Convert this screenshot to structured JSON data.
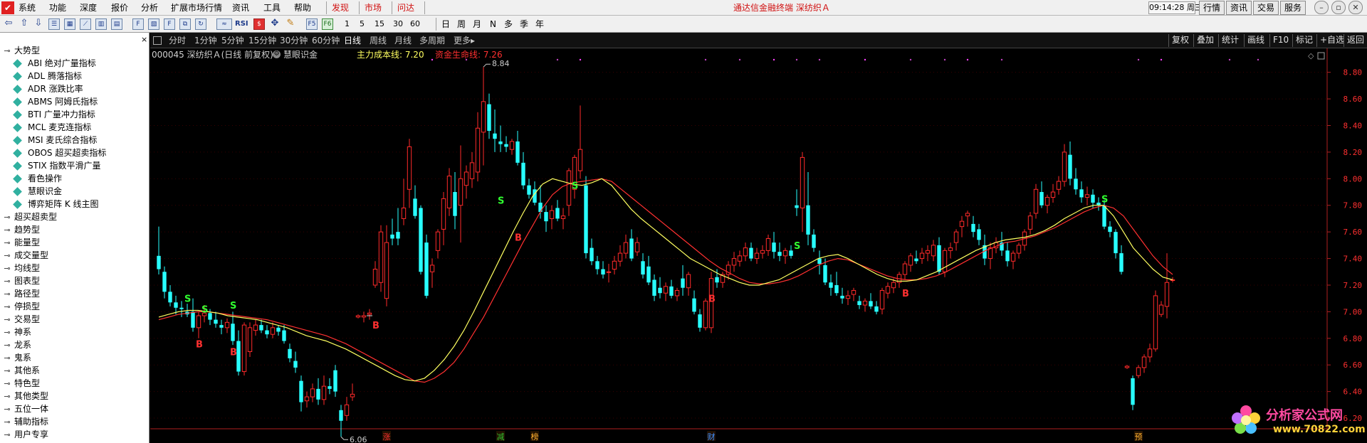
{
  "menubar": {
    "items": [
      "系统",
      "功能",
      "深度",
      "报价",
      "分析",
      "扩展市场行情",
      "资讯",
      "工具",
      "帮助"
    ],
    "tabs": [
      "发现",
      "市场",
      "问达"
    ],
    "title": "通达信金融终端   深纺织Ａ",
    "clock": "09:14:28 周三",
    "buttons": [
      "行情",
      "资讯",
      "交易",
      "服务"
    ],
    "window_controls": [
      "minimize",
      "restore",
      "close"
    ]
  },
  "toolbar": {
    "icons": [
      "back-icon",
      "up-icon",
      "down-icon",
      "list-icon",
      "grid-icon",
      "line-chart-icon",
      "bar-chart-icon",
      "f10-icon",
      "f1-icon",
      "table-icon",
      "f2-icon",
      "multi-window-icon",
      "refresh-icon",
      "trend-icon",
      "rsi-icon",
      "dollar-icon",
      "move-icon",
      "pencil-icon",
      "f5-icon",
      "f6-icon"
    ],
    "rsi_label": "RSI",
    "numbers": [
      "1",
      "5",
      "15",
      "30",
      "60"
    ],
    "periods": [
      "日",
      "周",
      "月",
      "N",
      "多",
      "季",
      "年"
    ]
  },
  "sidebar": {
    "close": "×",
    "groups": [
      {
        "label": "大势型",
        "expanded": true,
        "children": [
          "ABI 绝对广量指标",
          "ADL 腾落指标",
          "ADR 涨跌比率",
          "ABMS 阿姆氏指标",
          "BTI 广量冲力指标",
          "MCL 麦克连指标",
          "MSI 麦氏综合指标",
          "OBOS 超买超卖指标",
          "STIX 指数平滑广量",
          "看色操作",
          "慧眼识金",
          "博弈矩阵 K 线主图"
        ]
      },
      {
        "label": "超买超卖型"
      },
      {
        "label": "趋势型"
      },
      {
        "label": "能量型"
      },
      {
        "label": "成交量型"
      },
      {
        "label": "均线型"
      },
      {
        "label": "图表型"
      },
      {
        "label": "路径型"
      },
      {
        "label": "停损型"
      },
      {
        "label": "交易型"
      },
      {
        "label": "神系"
      },
      {
        "label": "龙系"
      },
      {
        "label": "鬼系"
      },
      {
        "label": "其他系"
      },
      {
        "label": "特色型"
      },
      {
        "label": "其他类型"
      },
      {
        "label": "五位一体"
      },
      {
        "label": "辅助指标"
      },
      {
        "label": "用户专享"
      }
    ]
  },
  "periodbar": {
    "periods": [
      "分时",
      "1分钟",
      "5分钟",
      "15分钟",
      "30分钟",
      "60分钟",
      "日线",
      "周线",
      "月线",
      "多周期",
      "更多▸"
    ],
    "active": "日线",
    "right_buttons": [
      "复权",
      "叠加",
      "统计",
      "画线",
      "F10",
      "标记",
      "+自选",
      "返回"
    ]
  },
  "info": {
    "stock": "000045 深纺织Ａ(日线 前复权)",
    "indicator": "慧眼识金",
    "cost_label": "主力成本线: 7.20",
    "life_label": "资金生命线: 7.26"
  },
  "chart_data": {
    "type": "candlestick",
    "y_ticks": [
      "8.80",
      "8.60",
      "8.40",
      "8.20",
      "8.00",
      "7.80",
      "7.60",
      "7.40",
      "7.20",
      "7.00",
      "6.80",
      "6.60",
      "6.40",
      "6.20"
    ],
    "ylim": [
      6.12,
      8.98
    ],
    "high_label": "8.84",
    "low_label": "6.06",
    "colors": {
      "up": "#ff2a2a",
      "down": "#28ffff",
      "cost_line": "#ffff60",
      "life_line": "#ff3030",
      "signal_b": "#ff3030",
      "signal_s": "#30ff30"
    },
    "candles_ohlc": [
      [
        7.42,
        7.64,
        7.28,
        7.32
      ],
      [
        7.3,
        7.34,
        7.1,
        7.15
      ],
      [
        7.15,
        7.2,
        7.04,
        7.07
      ],
      [
        7.07,
        7.12,
        6.98,
        7.03
      ],
      [
        7.03,
        7.08,
        6.96,
        7.02
      ],
      [
        7.0,
        7.06,
        6.96,
        6.98
      ],
      [
        7.0,
        7.1,
        6.85,
        6.88
      ],
      [
        6.88,
        7.0,
        6.8,
        6.97
      ],
      [
        6.97,
        7.05,
        6.92,
        6.99
      ],
      [
        6.99,
        7.02,
        6.9,
        6.94
      ],
      [
        6.94,
        7.0,
        6.88,
        6.91
      ],
      [
        6.9,
        6.94,
        6.83,
        6.88
      ],
      [
        6.88,
        6.95,
        6.84,
        6.92
      ],
      [
        6.91,
        7.0,
        6.75,
        6.78
      ],
      [
        6.78,
        6.86,
        6.52,
        6.55
      ],
      [
        6.55,
        6.92,
        6.52,
        6.9
      ],
      [
        6.7,
        6.92,
        6.66,
        6.88
      ],
      [
        6.86,
        6.94,
        6.82,
        6.9
      ],
      [
        6.9,
        6.94,
        6.84,
        6.86
      ],
      [
        6.86,
        6.9,
        6.8,
        6.83
      ],
      [
        6.83,
        6.92,
        6.8,
        6.88
      ],
      [
        6.88,
        6.9,
        6.82,
        6.85
      ],
      [
        6.86,
        6.9,
        6.76,
        6.78
      ],
      [
        6.72,
        6.76,
        6.62,
        6.65
      ],
      [
        6.63,
        6.7,
        6.54,
        6.58
      ],
      [
        6.48,
        6.52,
        6.25,
        6.32
      ],
      [
        6.33,
        6.4,
        6.28,
        6.36
      ],
      [
        6.36,
        6.46,
        6.32,
        6.42
      ],
      [
        6.42,
        6.5,
        6.3,
        6.34
      ],
      [
        6.34,
        6.52,
        6.3,
        6.44
      ],
      [
        6.44,
        6.5,
        6.38,
        6.42
      ],
      [
        6.56,
        6.6,
        6.36,
        6.4
      ],
      [
        6.26,
        6.3,
        6.06,
        6.18
      ],
      [
        6.22,
        6.36,
        6.18,
        6.3
      ],
      [
        6.36,
        6.46,
        6.33,
        6.38
      ],
      [
        6.96,
        6.98,
        6.95,
        6.97
      ],
      [
        6.96,
        7.0,
        6.92,
        6.97
      ],
      [
        6.98,
        7.02,
        6.94,
        6.99
      ],
      [
        7.2,
        7.38,
        7.18,
        7.32
      ],
      [
        7.22,
        7.65,
        7.15,
        7.6
      ],
      [
        7.1,
        7.65,
        7.04,
        7.52
      ],
      [
        7.58,
        7.7,
        7.5,
        7.55
      ],
      [
        7.6,
        7.78,
        7.5,
        7.55
      ],
      [
        7.7,
        8.0,
        7.65,
        7.78
      ],
      [
        7.92,
        8.3,
        7.78,
        8.24
      ],
      [
        7.85,
        7.95,
        7.7,
        7.72
      ],
      [
        7.78,
        7.8,
        7.28,
        7.3
      ],
      [
        7.52,
        7.58,
        7.1,
        7.12
      ],
      [
        7.3,
        7.4,
        7.18,
        7.35
      ],
      [
        7.46,
        7.62,
        7.4,
        7.6
      ],
      [
        7.62,
        7.9,
        7.5,
        7.85
      ],
      [
        7.78,
        8.08,
        7.72,
        8.02
      ],
      [
        7.9,
        8.05,
        7.62,
        7.72
      ],
      [
        7.8,
        8.25,
        7.52,
        8.0
      ],
      [
        7.95,
        8.1,
        7.85,
        8.05
      ],
      [
        8.0,
        8.2,
        7.93,
        8.12
      ],
      [
        8.05,
        8.5,
        7.98,
        8.38
      ],
      [
        8.35,
        8.84,
        8.1,
        8.58
      ],
      [
        8.56,
        8.64,
        8.3,
        8.36
      ],
      [
        8.34,
        8.52,
        8.2,
        8.3
      ],
      [
        8.28,
        8.4,
        8.2,
        8.26
      ],
      [
        8.26,
        8.32,
        8.2,
        8.24
      ],
      [
        8.22,
        8.3,
        8.18,
        8.28
      ],
      [
        8.28,
        8.36,
        8.1,
        8.12
      ],
      [
        8.12,
        8.2,
        7.92,
        7.95
      ],
      [
        7.95,
        8.0,
        7.85,
        7.88
      ],
      [
        7.92,
        7.98,
        7.8,
        7.82
      ],
      [
        7.82,
        7.95,
        7.7,
        7.75
      ],
      [
        7.75,
        7.8,
        7.6,
        7.68
      ],
      [
        7.7,
        7.8,
        7.62,
        7.76
      ],
      [
        7.78,
        7.84,
        7.68,
        7.7
      ],
      [
        7.7,
        7.78,
        7.62,
        7.72
      ],
      [
        7.8,
        8.08,
        7.72,
        8.06
      ],
      [
        7.92,
        8.18,
        7.85,
        8.16
      ],
      [
        8.06,
        8.55,
        8.0,
        8.22
      ],
      [
        7.95,
        8.02,
        7.4,
        7.44
      ],
      [
        7.48,
        7.55,
        7.35,
        7.38
      ],
      [
        7.38,
        7.42,
        7.28,
        7.32
      ],
      [
        7.32,
        7.38,
        7.25,
        7.28
      ],
      [
        7.3,
        7.36,
        7.22,
        7.3
      ],
      [
        7.32,
        7.42,
        7.28,
        7.38
      ],
      [
        7.38,
        7.5,
        7.34,
        7.44
      ],
      [
        7.44,
        7.58,
        7.4,
        7.52
      ],
      [
        7.55,
        7.62,
        7.38,
        7.4
      ],
      [
        7.45,
        7.56,
        7.42,
        7.52
      ],
      [
        7.38,
        7.44,
        7.25,
        7.28
      ],
      [
        7.34,
        7.42,
        7.2,
        7.22
      ],
      [
        7.24,
        7.28,
        7.08,
        7.12
      ],
      [
        7.18,
        7.26,
        7.1,
        7.14
      ],
      [
        7.14,
        7.22,
        7.08,
        7.19
      ],
      [
        7.19,
        7.24,
        7.1,
        7.12
      ],
      [
        7.12,
        7.18,
        7.08,
        7.16
      ],
      [
        7.25,
        7.35,
        7.12,
        7.18
      ],
      [
        7.18,
        7.3,
        7.12,
        7.28
      ],
      [
        7.1,
        7.16,
        6.98,
        7.0
      ],
      [
        6.98,
        7.02,
        6.85,
        6.88
      ],
      [
        6.88,
        7.1,
        6.86,
        7.08
      ],
      [
        6.88,
        7.3,
        6.84,
        7.25
      ],
      [
        7.26,
        7.32,
        7.18,
        7.22
      ],
      [
        7.22,
        7.3,
        7.18,
        7.28
      ],
      [
        7.28,
        7.38,
        7.24,
        7.35
      ],
      [
        7.35,
        7.45,
        7.3,
        7.4
      ],
      [
        7.38,
        7.46,
        7.34,
        7.42
      ],
      [
        7.42,
        7.52,
        7.38,
        7.48
      ],
      [
        7.48,
        7.52,
        7.38,
        7.4
      ],
      [
        7.4,
        7.48,
        7.36,
        7.44
      ],
      [
        7.44,
        7.5,
        7.4,
        7.46
      ],
      [
        7.46,
        7.58,
        7.42,
        7.55
      ],
      [
        7.52,
        7.6,
        7.4,
        7.45
      ],
      [
        7.45,
        7.52,
        7.38,
        7.42
      ],
      [
        7.42,
        7.48,
        7.36,
        7.46
      ],
      [
        7.46,
        7.5,
        7.4,
        7.42
      ],
      [
        7.8,
        7.92,
        7.72,
        7.78
      ],
      [
        7.78,
        8.2,
        7.6,
        8.16
      ],
      [
        7.8,
        8.05,
        7.5,
        7.58
      ],
      [
        7.58,
        7.62,
        7.45,
        7.48
      ],
      [
        7.4,
        7.46,
        7.28,
        7.36
      ],
      [
        7.35,
        7.4,
        7.2,
        7.22
      ],
      [
        7.22,
        7.28,
        7.12,
        7.18
      ],
      [
        7.2,
        7.3,
        7.12,
        7.14
      ],
      [
        7.12,
        7.18,
        7.06,
        7.1
      ],
      [
        7.1,
        7.16,
        7.05,
        7.12
      ],
      [
        7.13,
        7.18,
        7.08,
        7.16
      ],
      [
        7.08,
        7.12,
        7.02,
        7.05
      ],
      [
        7.05,
        7.1,
        7.0,
        7.08
      ],
      [
        7.08,
        7.14,
        7.02,
        7.04
      ],
      [
        7.04,
        7.08,
        6.98,
        7.0
      ],
      [
        7.02,
        7.18,
        6.98,
        7.16
      ],
      [
        7.14,
        7.22,
        7.1,
        7.19
      ],
      [
        7.18,
        7.25,
        7.14,
        7.22
      ],
      [
        7.22,
        7.3,
        7.18,
        7.28
      ],
      [
        7.28,
        7.38,
        7.24,
        7.36
      ],
      [
        7.35,
        7.44,
        7.3,
        7.42
      ],
      [
        7.4,
        7.46,
        7.36,
        7.38
      ],
      [
        7.4,
        7.48,
        7.36,
        7.44
      ],
      [
        7.44,
        7.5,
        7.38,
        7.46
      ],
      [
        7.42,
        7.54,
        7.38,
        7.5
      ],
      [
        7.5,
        7.56,
        7.28,
        7.3
      ],
      [
        7.3,
        7.48,
        7.26,
        7.46
      ],
      [
        7.46,
        7.52,
        7.4,
        7.48
      ],
      [
        7.52,
        7.62,
        7.46,
        7.6
      ],
      [
        7.64,
        7.72,
        7.56,
        7.68
      ],
      [
        7.72,
        7.76,
        7.64,
        7.74
      ],
      [
        7.66,
        7.72,
        7.56,
        7.6
      ],
      [
        7.62,
        7.66,
        7.5,
        7.54
      ],
      [
        7.5,
        7.58,
        7.35,
        7.4
      ],
      [
        7.4,
        7.52,
        7.32,
        7.48
      ],
      [
        7.48,
        7.56,
        7.44,
        7.52
      ],
      [
        7.52,
        7.6,
        7.42,
        7.46
      ],
      [
        7.46,
        7.52,
        7.34,
        7.38
      ],
      [
        7.38,
        7.46,
        7.32,
        7.44
      ],
      [
        7.44,
        7.52,
        7.4,
        7.5
      ],
      [
        7.5,
        7.62,
        7.46,
        7.6
      ],
      [
        7.62,
        7.75,
        7.58,
        7.72
      ],
      [
        7.74,
        7.96,
        7.7,
        7.92
      ],
      [
        7.9,
        7.98,
        7.78,
        7.8
      ],
      [
        7.8,
        7.88,
        7.74,
        7.86
      ],
      [
        7.86,
        7.96,
        7.82,
        7.9
      ],
      [
        7.92,
        8.02,
        7.88,
        7.98
      ],
      [
        7.98,
        8.26,
        7.94,
        8.2
      ],
      [
        8.18,
        8.28,
        7.95,
        8.0
      ],
      [
        8.0,
        8.08,
        7.88,
        7.92
      ],
      [
        7.92,
        7.98,
        7.82,
        7.86
      ],
      [
        7.86,
        7.94,
        7.8,
        7.88
      ],
      [
        7.88,
        7.92,
        7.78,
        7.82
      ],
      [
        7.82,
        7.86,
        7.76,
        7.8
      ],
      [
        7.8,
        7.84,
        7.62,
        7.64
      ],
      [
        7.64,
        7.68,
        7.56,
        7.6
      ],
      [
        7.6,
        7.62,
        7.4,
        7.44
      ],
      [
        7.44,
        7.5,
        7.28,
        7.3
      ],
      [
        6.58,
        6.6,
        6.57,
        6.59
      ],
      [
        6.5,
        6.52,
        6.26,
        6.3
      ],
      [
        6.52,
        6.6,
        6.5,
        6.58
      ],
      [
        6.58,
        6.68,
        6.54,
        6.66
      ],
      [
        6.66,
        6.76,
        6.62,
        6.72
      ],
      [
        6.72,
        7.16,
        6.7,
        7.12
      ],
      [
        6.98,
        7.08,
        6.96,
        7.05
      ],
      [
        7.04,
        7.44,
        6.95,
        7.22
      ],
      [
        7.24,
        7.26,
        7.22,
        7.24
      ]
    ],
    "cost_line": [
      6.96,
      6.98,
      7.0,
      7.01,
      7.01,
      7.0,
      6.99,
      6.97,
      6.96,
      6.95,
      6.94,
      6.92,
      6.9,
      6.88,
      6.85,
      6.82,
      6.8,
      6.78,
      6.75,
      6.72,
      6.68,
      6.64,
      6.6,
      6.56,
      6.52,
      6.49,
      6.48,
      6.5,
      6.56,
      6.64,
      6.74,
      6.86,
      7.0,
      7.15,
      7.3,
      7.45,
      7.6,
      7.74,
      7.87,
      7.96,
      8.0,
      7.98,
      7.96,
      7.95,
      7.97,
      8.0,
      7.95,
      7.86,
      7.77,
      7.7,
      7.64,
      7.58,
      7.52,
      7.46,
      7.4,
      7.36,
      7.32,
      7.28,
      7.25,
      7.22,
      7.2,
      7.2,
      7.22,
      7.24,
      7.28,
      7.32,
      7.36,
      7.4,
      7.42,
      7.43,
      7.4,
      7.36,
      7.32,
      7.28,
      7.25,
      7.23,
      7.23,
      7.24,
      7.27,
      7.3,
      7.34,
      7.38,
      7.42,
      7.46,
      7.49,
      7.52,
      7.54,
      7.55,
      7.56,
      7.58,
      7.61,
      7.65,
      7.7,
      7.74,
      7.78,
      7.8,
      7.8,
      7.72,
      7.6,
      7.48,
      7.4,
      7.32,
      7.26,
      7.24
    ],
    "life_line": [
      6.94,
      6.96,
      6.98,
      6.99,
      7.0,
      7.0,
      6.99,
      6.98,
      6.97,
      6.96,
      6.95,
      6.94,
      6.92,
      6.9,
      6.88,
      6.86,
      6.84,
      6.82,
      6.79,
      6.76,
      6.72,
      6.68,
      6.64,
      6.6,
      6.56,
      6.52,
      6.48,
      6.47,
      6.5,
      6.55,
      6.62,
      6.72,
      6.84,
      6.96,
      7.1,
      7.24,
      7.38,
      7.52,
      7.65,
      7.78,
      7.88,
      7.94,
      7.97,
      7.98,
      7.99,
      8.0,
      7.98,
      7.92,
      7.86,
      7.8,
      7.74,
      7.68,
      7.62,
      7.56,
      7.5,
      7.44,
      7.38,
      7.33,
      7.29,
      7.25,
      7.22,
      7.21,
      7.21,
      7.22,
      7.24,
      7.27,
      7.31,
      7.35,
      7.38,
      7.4,
      7.39,
      7.36,
      7.33,
      7.3,
      7.27,
      7.25,
      7.24,
      7.24,
      7.25,
      7.27,
      7.3,
      7.34,
      7.38,
      7.42,
      7.46,
      7.49,
      7.52,
      7.53,
      7.55,
      7.57,
      7.6,
      7.63,
      7.67,
      7.71,
      7.75,
      7.78,
      7.8,
      7.78,
      7.72,
      7.62,
      7.52,
      7.42,
      7.34,
      7.28
    ],
    "signals": [
      {
        "t": "S",
        "i": 5,
        "v": 7.1
      },
      {
        "t": "S",
        "i": 8,
        "v": 7.02
      },
      {
        "t": "S",
        "i": 13,
        "v": 7.05
      },
      {
        "t": "B",
        "i": 7,
        "v": 6.76
      },
      {
        "t": "B",
        "i": 13,
        "v": 6.7
      },
      {
        "t": "B",
        "i": 38,
        "v": 6.9
      },
      {
        "t": "S",
        "i": 60,
        "v": 7.84
      },
      {
        "t": "B",
        "i": 63,
        "v": 7.56
      },
      {
        "t": "S",
        "i": 73,
        "v": 7.95
      },
      {
        "t": "B",
        "i": 97,
        "v": 7.1
      },
      {
        "t": "S",
        "i": 112,
        "v": 7.5
      },
      {
        "t": "B",
        "i": 131,
        "v": 7.14
      },
      {
        "t": "S",
        "i": 166,
        "v": 7.85
      }
    ],
    "bottom_markers": [
      {
        "label": "涨",
        "i": 40
      },
      {
        "label": "减",
        "i": 60
      },
      {
        "label": "榜",
        "i": 66
      },
      {
        "label": "财",
        "i": 97
      },
      {
        "label": "预",
        "i": 172
      }
    ]
  },
  "watermark": {
    "title": "分析家公式网",
    "url": "www.70822.com"
  }
}
